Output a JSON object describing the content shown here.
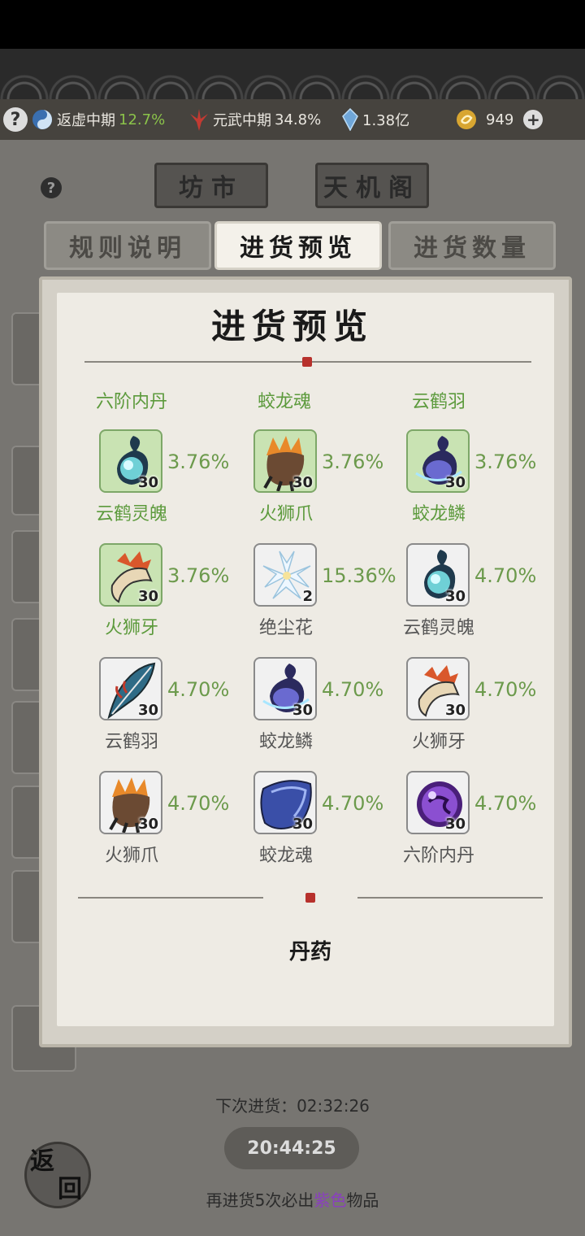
{
  "status": {
    "realm1_name": "返虚中期",
    "realm1_pct": "12.7%",
    "realm2_name": "元武中期",
    "realm2_pct": "34.8%",
    "crystal": "1.38亿",
    "coins": "949"
  },
  "header_buttons": {
    "market": "坊市",
    "tianji": "天机阁"
  },
  "tabs": [
    {
      "label": "规则说明",
      "active": false
    },
    {
      "label": "进货预览",
      "active": true
    },
    {
      "label": "进货数量",
      "active": false
    }
  ],
  "panel": {
    "title": "进货预览",
    "categories": [
      "六阶内丹",
      "蛟龙魂",
      "云鹤羽"
    ],
    "items": [
      {
        "icon": "blue-spirit-icon",
        "count": "30",
        "pct": "3.76%",
        "name": "云鹤灵魄",
        "highlight": true
      },
      {
        "icon": "lion-claw-icon",
        "count": "30",
        "pct": "3.76%",
        "name": "火狮爪",
        "highlight": true
      },
      {
        "icon": "dragon-scale-icon",
        "count": "30",
        "pct": "3.76%",
        "name": "蛟龙鳞",
        "highlight": true
      },
      {
        "icon": "lion-fang-icon",
        "count": "30",
        "pct": "3.76%",
        "name": "火狮牙",
        "highlight": true
      },
      {
        "icon": "lily-flower-icon",
        "count": "2",
        "pct": "15.36%",
        "name": "绝尘花",
        "highlight": false
      },
      {
        "icon": "blue-spirit-icon",
        "count": "30",
        "pct": "4.70%",
        "name": "云鹤灵魄",
        "highlight": false
      },
      {
        "icon": "crane-feather-icon",
        "count": "30",
        "pct": "4.70%",
        "name": "云鹤羽",
        "highlight": false
      },
      {
        "icon": "dragon-scale-icon",
        "count": "30",
        "pct": "4.70%",
        "name": "蛟龙鳞",
        "highlight": false
      },
      {
        "icon": "lion-fang-icon",
        "count": "30",
        "pct": "4.70%",
        "name": "火狮牙",
        "highlight": false
      },
      {
        "icon": "lion-claw-icon",
        "count": "30",
        "pct": "4.70%",
        "name": "火狮爪",
        "highlight": false
      },
      {
        "icon": "dragon-soul-icon",
        "count": "30",
        "pct": "4.70%",
        "name": "蛟龙魂",
        "highlight": false
      },
      {
        "icon": "purple-core-icon",
        "count": "30",
        "pct": "4.70%",
        "name": "六阶内丹",
        "highlight": false
      }
    ],
    "section_label": "丹药"
  },
  "footer": {
    "next_restock_label": "下次进货：02:32:26",
    "timer": "20:44:25",
    "guarantee_prefix": "再进货5次必出",
    "guarantee_highlight": "紫色",
    "guarantee_suffix": "物品",
    "return_top": "返",
    "return_bottom": "回"
  },
  "colors": {
    "accent_green": "#5c9a3c",
    "purple": "#8a3fbf",
    "seal_red": "#b7312c"
  }
}
